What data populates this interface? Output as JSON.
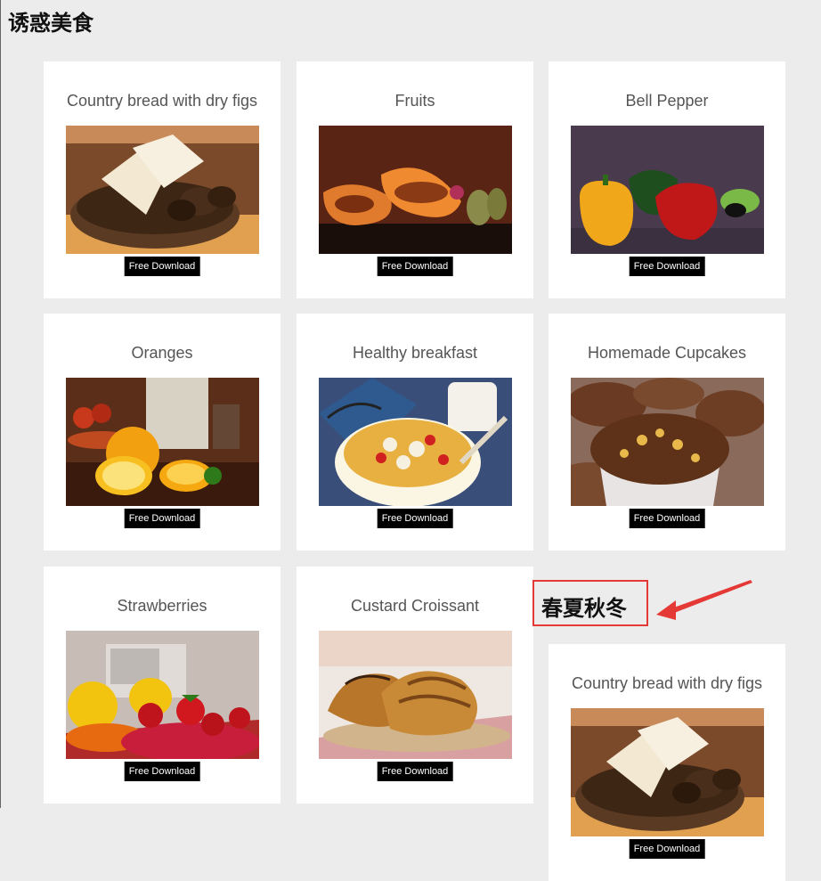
{
  "page": {
    "title": "诱惑美食"
  },
  "cards": [
    {
      "title": "Country bread with dry figs",
      "image": "bread-basket-photo",
      "button": "Free Download"
    },
    {
      "title": "Fruits",
      "image": "papaya-pears-photo",
      "button": "Free Download"
    },
    {
      "title": "Bell Pepper",
      "image": "bell-peppers-photo",
      "button": "Free Download"
    },
    {
      "title": "Oranges",
      "image": "oranges-photo",
      "button": "Free Download"
    },
    {
      "title": "Healthy breakfast",
      "image": "cereal-bowl-photo",
      "button": "Free Download"
    },
    {
      "title": "Homemade Cupcakes",
      "image": "cupcakes-photo",
      "button": "Free Download"
    },
    {
      "title": "Strawberries",
      "image": "strawberries-photo",
      "button": "Free Download"
    },
    {
      "title": "Custard Croissant",
      "image": "croissant-photo",
      "button": "Free Download"
    },
    {
      "title": "Country bread with dry figs",
      "image": "bread-basket-photo",
      "button": "Free Download"
    }
  ],
  "annotation": {
    "label": "春夏秋冬",
    "border_color": "#e53935",
    "arrow_color": "#e53935"
  }
}
